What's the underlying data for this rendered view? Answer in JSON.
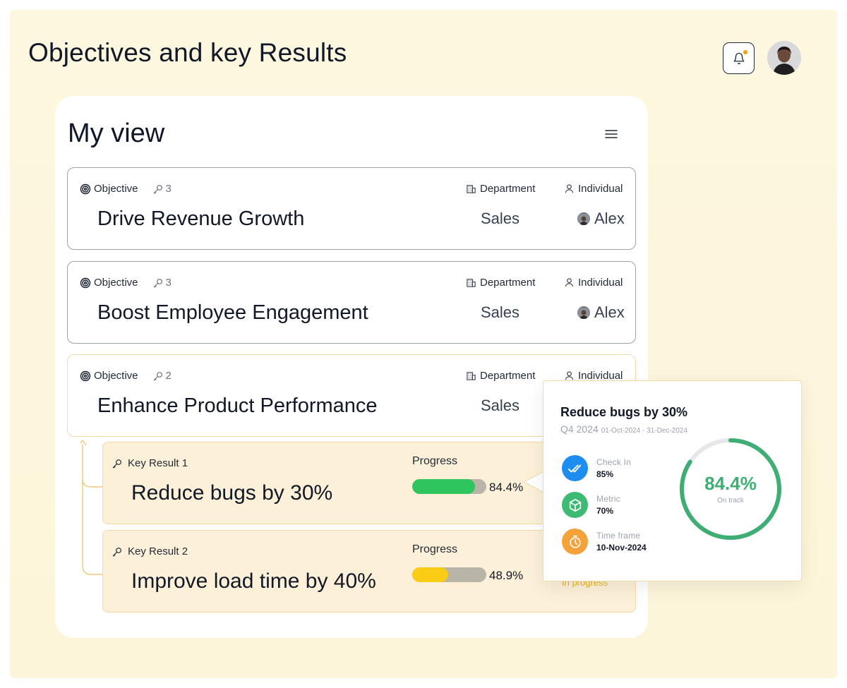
{
  "header": {
    "title": "Objectives and key Results"
  },
  "main": {
    "view_title": "My view",
    "objectives": [
      {
        "type_label": "Objective",
        "key_count": "3",
        "title": "Drive Revenue Growth",
        "dept_label": "Department",
        "dept_value": "Sales",
        "indiv_label": "Individual",
        "indiv_value": "Alex"
      },
      {
        "type_label": "Objective",
        "key_count": "3",
        "title": "Boost Employee Engagement",
        "dept_label": "Department",
        "dept_value": "Sales",
        "indiv_label": "Individual",
        "indiv_value": "Alex"
      },
      {
        "type_label": "Objective",
        "key_count": "2",
        "title": "Enhance Product Performance",
        "dept_label": "Department",
        "dept_value": "Sales",
        "indiv_label": "Individual"
      }
    ],
    "key_results": [
      {
        "label": "Key Result 1",
        "title": "Reduce bugs by 30%",
        "progress_label": "Progress",
        "progress_value": "84.4%",
        "progress_fraction": 0.844,
        "bar_color": "#2ec55f"
      },
      {
        "label": "Key Result 2",
        "title": "Improve load time by 40%",
        "progress_label": "Progress",
        "progress_value": "48.9%",
        "progress_fraction": 0.489,
        "bar_color": "#facc15",
        "status": "In progress"
      }
    ]
  },
  "popover": {
    "title": "Reduce bugs by 30%",
    "quarter": "Q4 2024",
    "dates": "01-Oct-2024 - 31-Dec-2024",
    "metrics": [
      {
        "label": "Check In",
        "value": "85%",
        "icon": "double-check-icon",
        "color": "#1d8ef0"
      },
      {
        "label": "Metric",
        "value": "70%",
        "icon": "cube-icon",
        "color": "#3dbb74"
      },
      {
        "label": "Time frame",
        "value": "10-Nov-2024",
        "icon": "timer-icon",
        "color": "#f5a23a"
      }
    ],
    "ring_value": "84.4%",
    "ring_fraction": 0.844,
    "ring_caption": "On track",
    "ring_color": "#3fae74"
  }
}
